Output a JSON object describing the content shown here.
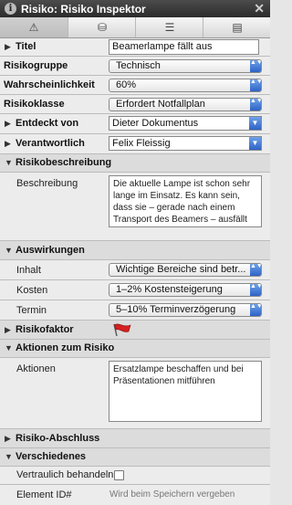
{
  "window": {
    "title": "Risiko: Risiko Inspektor",
    "close_symbol": "✕",
    "info_symbol": "i"
  },
  "tabs": [
    {
      "icon": "warning-icon",
      "glyph": "⚠",
      "active": true
    },
    {
      "icon": "database-icon",
      "glyph": "⛁",
      "active": false
    },
    {
      "icon": "list-icon",
      "glyph": "☰",
      "active": false
    },
    {
      "icon": "document-icon",
      "glyph": "▤",
      "active": false
    }
  ],
  "triangle_closed": "▶",
  "triangle_open": "▼",
  "popup_arrows": "▲▼",
  "combo_arrow": "▼",
  "fields": {
    "titel": {
      "label": "Titel",
      "value": "Beamerlampe fällt aus"
    },
    "risikogruppe": {
      "label": "Risikogruppe",
      "value": "Technisch"
    },
    "wahrscheinlichkeit": {
      "label": "Wahrscheinlichkeit",
      "value": "60%"
    },
    "risikoklasse": {
      "label": "Risikoklasse",
      "value": "Erfordert Notfallplan"
    },
    "entdeckt_von": {
      "label": "Entdeckt von",
      "value": "Dieter Dokumentus"
    },
    "verantwortlich": {
      "label": "Verantwortlich",
      "value": "Felix Fleissig"
    }
  },
  "risikobeschreibung": {
    "header": "Risikobeschreibung",
    "label": "Beschreibung",
    "text": "Die aktuelle Lampe ist schon sehr lange im Einsatz. Es kann sein, dass sie – gerade nach einem Transport des Beamers – ausfällt"
  },
  "auswirkungen": {
    "header": "Auswirkungen",
    "inhalt": {
      "label": "Inhalt",
      "value": "Wichtige Bereiche sind betr..."
    },
    "kosten": {
      "label": "Kosten",
      "value": "1–2% Kostensteigerung"
    },
    "termin": {
      "label": "Termin",
      "value": "5–10% Terminverzögerung"
    }
  },
  "risikofaktor": {
    "label": "Risikofaktor",
    "icon": "red-flag-icon"
  },
  "aktionen": {
    "header": "Aktionen zum Risiko",
    "label": "Aktionen",
    "text": "Ersatzlampe beschaffen und bei Präsentationen mitführen"
  },
  "abschluss": {
    "header": "Risiko-Abschluss"
  },
  "verschiedenes": {
    "header": "Verschiedenes",
    "vertraulich": {
      "label": "Vertraulich behandeln",
      "checked": false
    },
    "element_id": {
      "label": "Element ID#",
      "value": "Wird beim Speichern vergeben"
    }
  },
  "colors": {
    "titlebar": "#3a3a3a",
    "accent": "#3b72d6",
    "flag": "#d42020"
  }
}
